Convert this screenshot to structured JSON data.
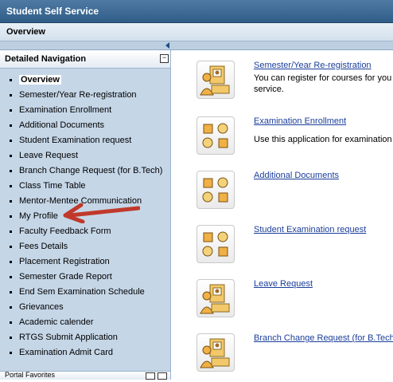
{
  "header": {
    "title": "Student Self Service"
  },
  "tabs": {
    "active": "Overview"
  },
  "nav": {
    "heading": "Detailed Navigation",
    "items": [
      "Overview",
      "Semester/Year Re-registration",
      "Examination Enrollment",
      "Additional Documents",
      "Student Examination request",
      "Leave Request",
      "Branch Change Request (for B.Tech)",
      "Class Time Table",
      "Mentor-Mentee Communication",
      "My Profile",
      "Faculty Feedback Form",
      "Fees Details",
      "Placement Registration",
      "Semester Grade Report",
      "End Sem Examination Schedule",
      "Grievances",
      "Academic calender",
      "RTGS Submit Application",
      "Examination Admit Card"
    ],
    "footer_label": "Portal Favorites",
    "annotation_color": "#c0392b"
  },
  "services": [
    {
      "title": "Semester/Year Re-registration",
      "description": "You can register for courses for you",
      "description2": "service.",
      "icon": "person-computer-icon"
    },
    {
      "title": "Examination Enrollment",
      "description": "Use this application for examination",
      "description2": "",
      "icon": "shapes-grid-icon"
    },
    {
      "title": "Additional Documents",
      "description": "",
      "description2": "",
      "icon": "shapes-grid-icon"
    },
    {
      "title": "Student Examination request",
      "description": "",
      "description2": "",
      "icon": "shapes-grid-icon"
    },
    {
      "title": "Leave Request",
      "description": "",
      "description2": "",
      "icon": "person-computer-icon"
    },
    {
      "title": "Branch Change Request (for B.Tech",
      "description": "",
      "description2": "",
      "icon": "person-computer-icon"
    }
  ]
}
